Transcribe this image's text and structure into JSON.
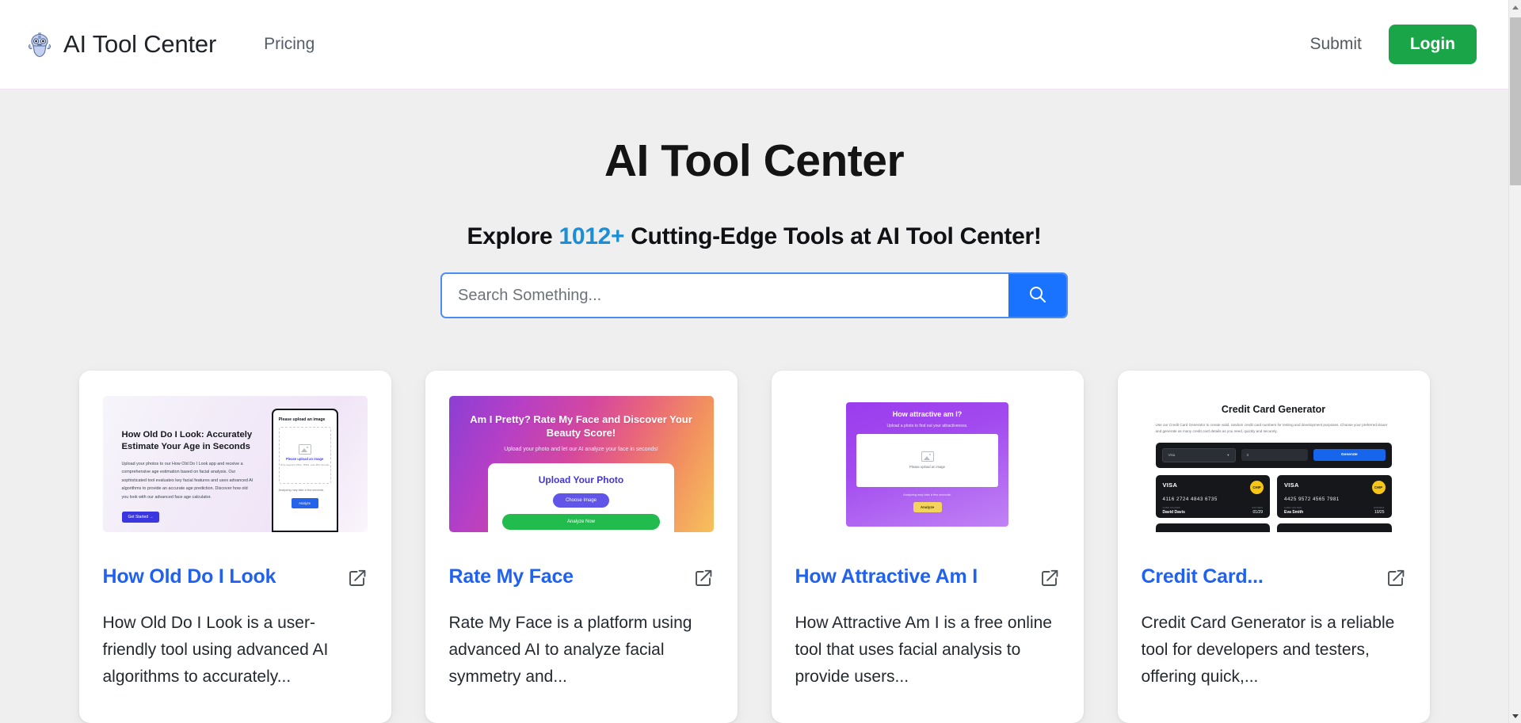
{
  "header": {
    "logo_icon": "robot-icon",
    "brand_title": "AI Tool Center",
    "nav": [
      {
        "label": "Pricing"
      }
    ],
    "submit_label": "Submit",
    "login_label": "Login",
    "login_color": "#1aa549",
    "border_color": "#efe1f3"
  },
  "hero": {
    "title": "AI Tool Center",
    "subtitle_before": "Explore ",
    "subtitle_count": "1012+",
    "subtitle_after": " Cutting-Edge Tools at AI Tool Center!",
    "count_color": "#1c8ed4"
  },
  "search": {
    "placeholder": "Search Something...",
    "value": "",
    "button_icon": "search-icon",
    "button_color": "#1a73ff",
    "border_color": "#4a8df3"
  },
  "cards": [
    {
      "title": "How Old Do I Look",
      "description": "How Old Do I Look is a user-friendly tool using advanced AI algorithms to accurately...",
      "link_icon": "external-link-icon",
      "thumb": {
        "heading": "How Old Do I Look: Accurately Estimate Your Age in Seconds",
        "paragraph": "Upload your photos to our How Old Do I Look app and receive a comprehensive age estimation based on facial analysis. Our sophisticated tool evaluates key facial features and uses advanced AI algorithms to provide an accurate age prediction. Discover how old you look with our advanced face age calculator.",
        "cta": "Get Started →",
        "panel_heading": "Please upload an image",
        "drop_title": "Please upload an image",
        "drop_subtitle": "Only supports PNG, JPEG, and JPG formats",
        "note": "Analyzing may take a few seconds.",
        "analyze": "Analyze"
      }
    },
    {
      "title": "Rate My Face",
      "description": "Rate My Face is a platform using advanced AI to analyze facial symmetry and...",
      "link_icon": "external-link-icon",
      "thumb": {
        "heading": "Am I Pretty? Rate My Face and Discover Your Beauty Score!",
        "subheading": "Upload your photo and let our AI analyze your face in seconds!",
        "panel_heading": "Upload Your Photo",
        "choose": "Choose Image",
        "analyze": "Analyze Now"
      }
    },
    {
      "title": "How Attractive Am I",
      "description": "How Attractive Am I is a free online tool that uses facial analysis to provide users...",
      "link_icon": "external-link-icon",
      "thumb": {
        "heading": "How attractive am I?",
        "subheading": "Upload a photo to find out your attractiveness.",
        "drop_title": "Please upload an image",
        "note": "Analyzing may take a few seconds.",
        "analyze": "Analyze"
      }
    },
    {
      "title": "Credit Card...",
      "description": "Credit Card Generator is a reliable tool for developers and testers, offering quick,...",
      "link_icon": "external-link-icon",
      "thumb": {
        "heading": "Credit Card Generator",
        "paragraph": "Use our Credit Card Generator to create valid, random credit card numbers for testing and development purposes. Choose your preferred issuer and generate as many credit card details as you need, quickly and securely.",
        "issuer_select": "Visa",
        "quantity": "3",
        "generate": "Generate",
        "cards": [
          {
            "brand": "VISA",
            "chip": "CHIP",
            "number": "4116 2724 4843 6735",
            "holder_label": "CARD HOLDER",
            "holder": "David Davis",
            "expires_label": "EXPIRES",
            "expires": "01/29"
          },
          {
            "brand": "VISA",
            "chip": "CHIP",
            "number": "4425 9572 4565 7981",
            "holder_label": "CARD HOLDER",
            "holder": "Eva Smith",
            "expires_label": "EXPIRES",
            "expires": "10/25"
          }
        ]
      }
    }
  ],
  "scrollbar": {
    "up_icon": "scroll-up-arrow-icon",
    "down_icon": "scroll-down-arrow-icon",
    "thumb_name": "scrollbar-thumb"
  }
}
